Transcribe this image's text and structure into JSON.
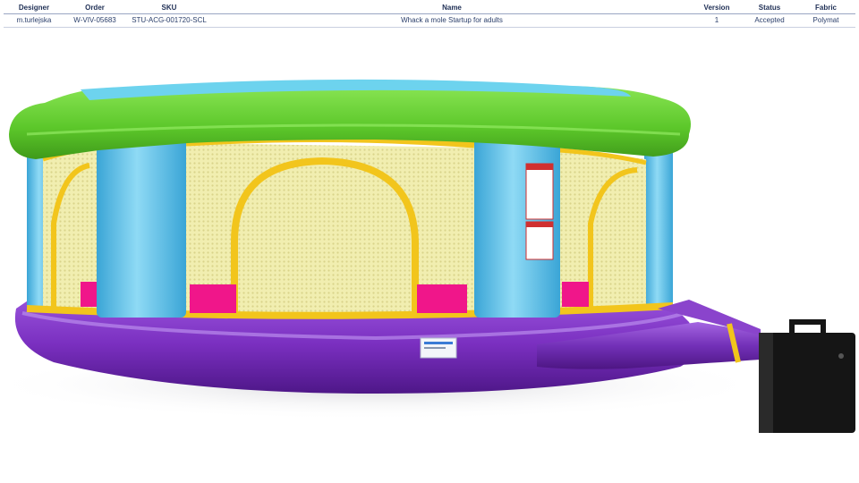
{
  "table": {
    "headers": {
      "designer": "Designer",
      "order": "Order",
      "sku": "SKU",
      "name": "Name",
      "version": "Version",
      "status": "Status",
      "fabric": "Fabric"
    },
    "row": {
      "designer": "m.turlejska",
      "order": "W-VIV-05683",
      "sku": "STU-ACG-001720-SCL",
      "name": "Whack a mole Startup for adults",
      "version": "1",
      "status": "Accepted",
      "fabric": "Polymat"
    }
  },
  "colors": {
    "roof_green": "#6fd63a",
    "wall_blue": "#5cc2e6",
    "base_purple": "#7a2fc0",
    "trim_yellow": "#f2c51c",
    "panel_pink": "#f0168a",
    "mesh_yellow": "#eeeaa0",
    "blower_black": "#111111"
  }
}
